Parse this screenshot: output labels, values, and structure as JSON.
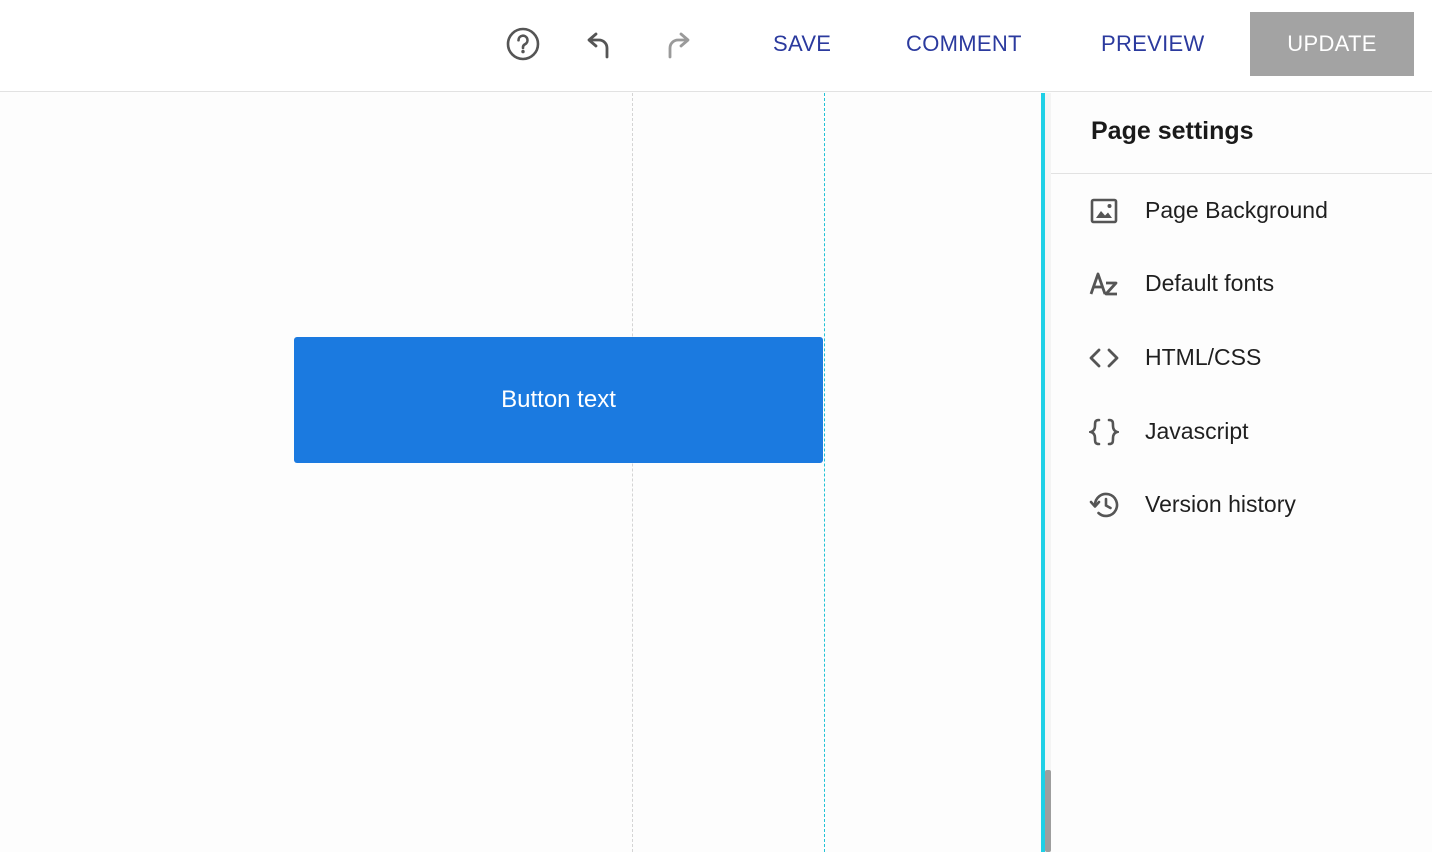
{
  "toolbar": {
    "help_icon": "help-circle-icon",
    "undo_icon": "undo-icon",
    "redo_icon": "redo-icon",
    "save_label": "SAVE",
    "comment_label": "COMMENT",
    "preview_label": "PREVIEW",
    "update_label": "UPDATE"
  },
  "canvas": {
    "button_text": "Button text"
  },
  "panel": {
    "title": "Page settings",
    "items": [
      {
        "icon": "image-icon",
        "label": "Page Background"
      },
      {
        "icon": "font-az-icon",
        "label": "Default fonts"
      },
      {
        "icon": "code-icon",
        "label": "HTML/CSS"
      },
      {
        "icon": "braces-icon",
        "label": "Javascript"
      },
      {
        "icon": "history-icon",
        "label": "Version history"
      }
    ]
  },
  "colors": {
    "accent_text": "#2b3a9e",
    "update_disabled": "#a3a3a3",
    "canvas_button": "#1b7ae0",
    "selection_cyan": "#1fd0e6"
  }
}
